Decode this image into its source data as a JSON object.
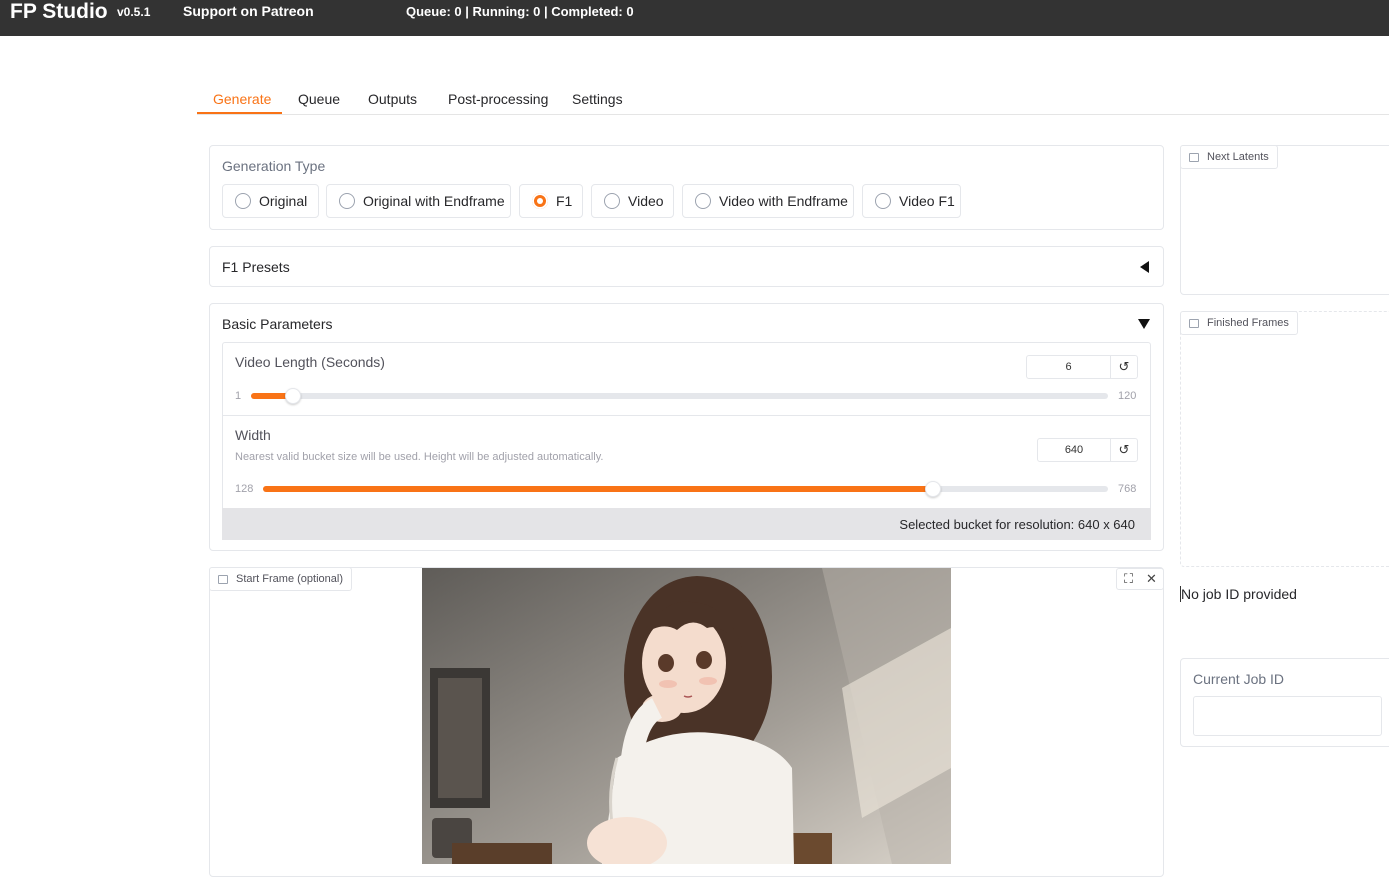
{
  "app": {
    "title": "FP Studio",
    "version": "v0.5.1",
    "patreon": "Support on Patreon",
    "queue_status": "Queue: 0 | Running: 0 | Completed: 0"
  },
  "tabs": [
    "Generate",
    "Queue",
    "Outputs",
    "Post-processing",
    "Settings"
  ],
  "active_tab": "Generate",
  "generation_type": {
    "label": "Generation Type",
    "options": [
      "Original",
      "Original with Endframe",
      "F1",
      "Video",
      "Video with Endframe",
      "Video F1"
    ],
    "selected": "F1"
  },
  "f1_presets": {
    "label": "F1 Presets"
  },
  "basic_parameters": {
    "label": "Basic Parameters",
    "video_length": {
      "label": "Video Length (Seconds)",
      "value": "6",
      "min": "1",
      "max": "120"
    },
    "width": {
      "label": "Width",
      "info": "Nearest valid bucket size will be used. Height will be adjusted automatically.",
      "value": "640",
      "min": "128",
      "max": "768"
    },
    "bucket_text": "Selected bucket for resolution: 640 x 640"
  },
  "start_frame": {
    "label": "Start Frame (optional)"
  },
  "right": {
    "next_latents": "Next Latents",
    "finished_frames": "Finished Frames",
    "no_job": "No job ID provided",
    "current_job_label": "Current Job ID",
    "current_job_value": ""
  },
  "colors": {
    "accent": "#f97316",
    "topbar": "#333333"
  },
  "icons": {
    "reset": "↺",
    "fullscreen": "⛶",
    "close": "✕"
  }
}
